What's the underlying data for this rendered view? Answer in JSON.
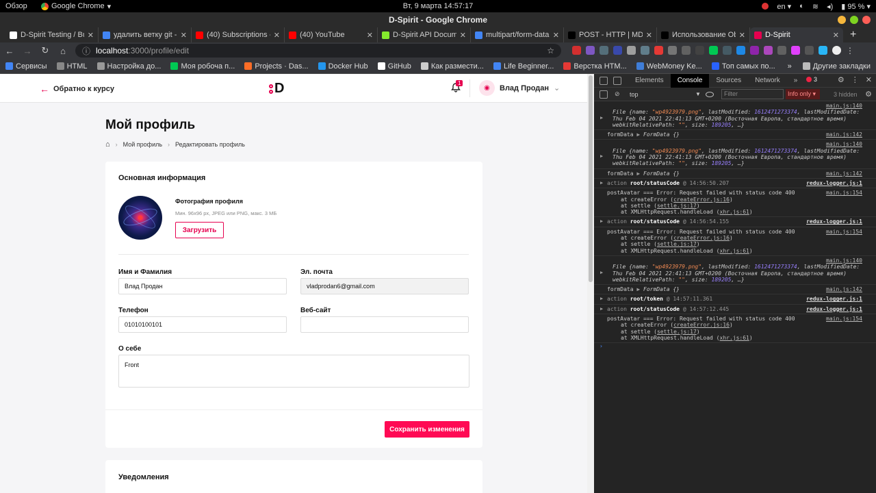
{
  "os": {
    "overview": "Обзор",
    "app_name": "Google Chrome",
    "clock": "Вт, 9 марта  14:57:17",
    "lang": "en",
    "battery": "95 %"
  },
  "window": {
    "title": "D-Spirit - Google Chrome"
  },
  "tabs": [
    {
      "label": "D-Spirit Testing / Bu",
      "color": "#ffffff"
    },
    {
      "label": "удалить ветку git - П",
      "color": "#4285f4"
    },
    {
      "label": "(40) Subscriptions - Y",
      "color": "#ff0000"
    },
    {
      "label": "(40) YouTube",
      "color": "#ff0000"
    },
    {
      "label": "D-Spirit API Docume",
      "color": "#85ea2d"
    },
    {
      "label": "multipart/form-data",
      "color": "#4285f4"
    },
    {
      "label": "POST - HTTP | MDN",
      "color": "#000000"
    },
    {
      "label": "Использование Ob",
      "color": "#000000"
    },
    {
      "label": "D-Spirit",
      "color": "#e6004f"
    }
  ],
  "address": {
    "host": "localhost",
    "path": ":3000/profile/edit"
  },
  "bookmarks": [
    {
      "label": "Сервисы",
      "color": "#4285f4"
    },
    {
      "label": "HTML",
      "color": "#888888"
    },
    {
      "label": "Настройка до...",
      "color": "#999999"
    },
    {
      "label": "Моя робоча п...",
      "color": "#00c853"
    },
    {
      "label": "Projects · Das...",
      "color": "#fc6d26"
    },
    {
      "label": "Docker Hub",
      "color": "#2496ed"
    },
    {
      "label": "GitHub",
      "color": "#ffffff"
    },
    {
      "label": "Как размести...",
      "color": "#cccccc"
    },
    {
      "label": "Life Beginner...",
      "color": "#4285f4"
    },
    {
      "label": "Верстка HTM...",
      "color": "#e53935"
    },
    {
      "label": "WebMoney Ke...",
      "color": "#3f7dd8"
    },
    {
      "label": "Топ самых по...",
      "color": "#2962ff"
    }
  ],
  "bookmarks_other": "Другие закладки",
  "header": {
    "back_label": "Обратно к курсу",
    "logo_letter": "D",
    "notif_count": "1",
    "user_name": "Влад Продан"
  },
  "page": {
    "title": "Мой профиль",
    "breadcrumbs": [
      "Мой профиль",
      "Редактировать профиль"
    ]
  },
  "profile": {
    "section_title": "Основная информация",
    "photo_label": "Фотография профиля",
    "photo_hint": "Мин. 96x96 px, JPEG или PNG, макс. 3 МБ",
    "upload_label": "Загрузить",
    "name_label": "Имя и Фамилия",
    "name_value": "Влад Продан",
    "email_label": "Эл. почта",
    "email_value": "vladprodan6@gmail.com",
    "phone_label": "Телефон",
    "phone_value": "01010100101",
    "website_label": "Веб-сайт",
    "website_value": "",
    "about_label": "О себе",
    "about_value": "Front",
    "save_label": "Сохранить изменения"
  },
  "notifications": {
    "title": "Уведомления"
  },
  "devtools": {
    "tabs": [
      "Elements",
      "Console",
      "Sources",
      "Network"
    ],
    "error_count": "3",
    "context": "top",
    "filter_placeholder": "Filter",
    "level": "Info only",
    "hidden": "3 hidden",
    "file_name": "\"wp4923979.png\"",
    "file_lastmod": "1612471273374",
    "file_date": "Thu Feb 04 2021 22:41:13 GMT+0200 (Восточная Европа, стандартное время)",
    "file_size": "189205",
    "formdata": "formData",
    "formdata_obj": "FormData {}",
    "src_main140": "main.js:140",
    "src_main142": "main.js:142",
    "src_main154": "main.js:154",
    "src_redux": "redux-logger.js:1",
    "action_status": "root/statusCode",
    "action_token": "root/token",
    "time1": "@ 14:56:50.207",
    "time2": "@ 14:56:54.155",
    "time3": "@ 14:57:11.361",
    "time4": "@ 14:57:12.445",
    "err_msg": "postAvatar ===  Error: Request failed with status code 400",
    "err_l1": "createError.js:16",
    "err_l2": "settle.js:17",
    "err_l3": "xhr.js:61"
  }
}
